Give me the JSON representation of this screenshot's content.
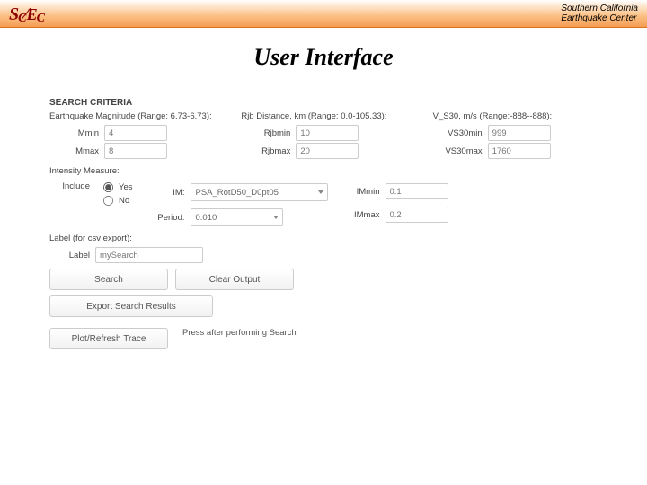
{
  "header": {
    "logo_text": "S C / E C",
    "org_line1": "Southern California",
    "org_line2": "Earthquake Center"
  },
  "slide": {
    "title": "User Interface"
  },
  "search": {
    "heading": "SEARCH CRITERIA",
    "mag": {
      "label": "Earthquake Magnitude (Range: 6.73-6.73):",
      "min_label": "Mmin",
      "min_val": "4",
      "max_label": "Mmax",
      "max_val": "8"
    },
    "rjb": {
      "label": "Rjb Distance, km (Range: 0.0-105.33):",
      "min_label": "Rjbmin",
      "min_val": "10",
      "max_label": "Rjbmax",
      "max_val": "20"
    },
    "vs30": {
      "label": "V_S30, m/s (Range:-888--888):",
      "min_label": "VS30min",
      "min_val": "999",
      "max_label": "VS30max",
      "max_val": "1760"
    },
    "im": {
      "heading": "Intensity Measure:",
      "include_label": "Include",
      "yes": "Yes",
      "no": "No",
      "im_label": "IM:",
      "im_val": "PSA_RotD50_D0pt05",
      "period_label": "Period:",
      "period_val": "0.010",
      "min_label": "IMmin",
      "min_val": "0.1",
      "max_label": "IMmax",
      "max_val": "0.2"
    },
    "label_section": {
      "heading": "Label (for csv export):",
      "label": "Label",
      "value": "mySearch"
    },
    "buttons": {
      "search": "Search",
      "clear": "Clear Output",
      "export": "Export Search Results",
      "plot": "Plot/Refresh Trace",
      "plot_hint": "Press after performing Search"
    }
  }
}
